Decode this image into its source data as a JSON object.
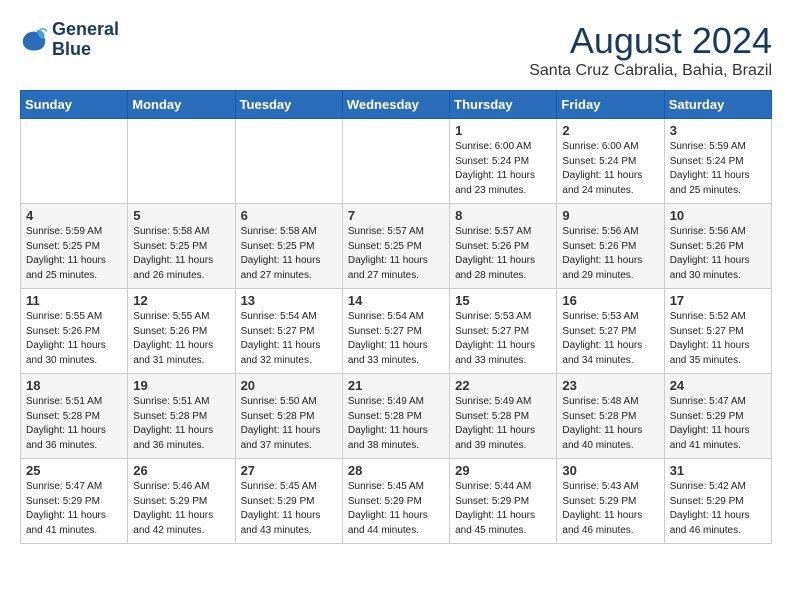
{
  "header": {
    "logo_line1": "General",
    "logo_line2": "Blue",
    "month_year": "August 2024",
    "location": "Santa Cruz Cabralia, Bahia, Brazil"
  },
  "weekdays": [
    "Sunday",
    "Monday",
    "Tuesday",
    "Wednesday",
    "Thursday",
    "Friday",
    "Saturday"
  ],
  "weeks": [
    [
      {
        "day": "",
        "sunrise": "",
        "sunset": "",
        "daylight": ""
      },
      {
        "day": "",
        "sunrise": "",
        "sunset": "",
        "daylight": ""
      },
      {
        "day": "",
        "sunrise": "",
        "sunset": "",
        "daylight": ""
      },
      {
        "day": "",
        "sunrise": "",
        "sunset": "",
        "daylight": ""
      },
      {
        "day": "1",
        "sunrise": "6:00 AM",
        "sunset": "5:24 PM",
        "daylight": "11 hours and 23 minutes."
      },
      {
        "day": "2",
        "sunrise": "6:00 AM",
        "sunset": "5:24 PM",
        "daylight": "11 hours and 24 minutes."
      },
      {
        "day": "3",
        "sunrise": "5:59 AM",
        "sunset": "5:24 PM",
        "daylight": "11 hours and 25 minutes."
      }
    ],
    [
      {
        "day": "4",
        "sunrise": "5:59 AM",
        "sunset": "5:25 PM",
        "daylight": "11 hours and 25 minutes."
      },
      {
        "day": "5",
        "sunrise": "5:58 AM",
        "sunset": "5:25 PM",
        "daylight": "11 hours and 26 minutes."
      },
      {
        "day": "6",
        "sunrise": "5:58 AM",
        "sunset": "5:25 PM",
        "daylight": "11 hours and 27 minutes."
      },
      {
        "day": "7",
        "sunrise": "5:57 AM",
        "sunset": "5:25 PM",
        "daylight": "11 hours and 27 minutes."
      },
      {
        "day": "8",
        "sunrise": "5:57 AM",
        "sunset": "5:26 PM",
        "daylight": "11 hours and 28 minutes."
      },
      {
        "day": "9",
        "sunrise": "5:56 AM",
        "sunset": "5:26 PM",
        "daylight": "11 hours and 29 minutes."
      },
      {
        "day": "10",
        "sunrise": "5:56 AM",
        "sunset": "5:26 PM",
        "daylight": "11 hours and 30 minutes."
      }
    ],
    [
      {
        "day": "11",
        "sunrise": "5:55 AM",
        "sunset": "5:26 PM",
        "daylight": "11 hours and 30 minutes."
      },
      {
        "day": "12",
        "sunrise": "5:55 AM",
        "sunset": "5:26 PM",
        "daylight": "11 hours and 31 minutes."
      },
      {
        "day": "13",
        "sunrise": "5:54 AM",
        "sunset": "5:27 PM",
        "daylight": "11 hours and 32 minutes."
      },
      {
        "day": "14",
        "sunrise": "5:54 AM",
        "sunset": "5:27 PM",
        "daylight": "11 hours and 33 minutes."
      },
      {
        "day": "15",
        "sunrise": "5:53 AM",
        "sunset": "5:27 PM",
        "daylight": "11 hours and 33 minutes."
      },
      {
        "day": "16",
        "sunrise": "5:53 AM",
        "sunset": "5:27 PM",
        "daylight": "11 hours and 34 minutes."
      },
      {
        "day": "17",
        "sunrise": "5:52 AM",
        "sunset": "5:27 PM",
        "daylight": "11 hours and 35 minutes."
      }
    ],
    [
      {
        "day": "18",
        "sunrise": "5:51 AM",
        "sunset": "5:28 PM",
        "daylight": "11 hours and 36 minutes."
      },
      {
        "day": "19",
        "sunrise": "5:51 AM",
        "sunset": "5:28 PM",
        "daylight": "11 hours and 36 minutes."
      },
      {
        "day": "20",
        "sunrise": "5:50 AM",
        "sunset": "5:28 PM",
        "daylight": "11 hours and 37 minutes."
      },
      {
        "day": "21",
        "sunrise": "5:49 AM",
        "sunset": "5:28 PM",
        "daylight": "11 hours and 38 minutes."
      },
      {
        "day": "22",
        "sunrise": "5:49 AM",
        "sunset": "5:28 PM",
        "daylight": "11 hours and 39 minutes."
      },
      {
        "day": "23",
        "sunrise": "5:48 AM",
        "sunset": "5:28 PM",
        "daylight": "11 hours and 40 minutes."
      },
      {
        "day": "24",
        "sunrise": "5:47 AM",
        "sunset": "5:29 PM",
        "daylight": "11 hours and 41 minutes."
      }
    ],
    [
      {
        "day": "25",
        "sunrise": "5:47 AM",
        "sunset": "5:29 PM",
        "daylight": "11 hours and 41 minutes."
      },
      {
        "day": "26",
        "sunrise": "5:46 AM",
        "sunset": "5:29 PM",
        "daylight": "11 hours and 42 minutes."
      },
      {
        "day": "27",
        "sunrise": "5:45 AM",
        "sunset": "5:29 PM",
        "daylight": "11 hours and 43 minutes."
      },
      {
        "day": "28",
        "sunrise": "5:45 AM",
        "sunset": "5:29 PM",
        "daylight": "11 hours and 44 minutes."
      },
      {
        "day": "29",
        "sunrise": "5:44 AM",
        "sunset": "5:29 PM",
        "daylight": "11 hours and 45 minutes."
      },
      {
        "day": "30",
        "sunrise": "5:43 AM",
        "sunset": "5:29 PM",
        "daylight": "11 hours and 46 minutes."
      },
      {
        "day": "31",
        "sunrise": "5:42 AM",
        "sunset": "5:29 PM",
        "daylight": "11 hours and 46 minutes."
      }
    ]
  ],
  "labels": {
    "sunrise_prefix": "Sunrise: ",
    "sunset_prefix": "Sunset: ",
    "daylight_prefix": "Daylight: "
  }
}
